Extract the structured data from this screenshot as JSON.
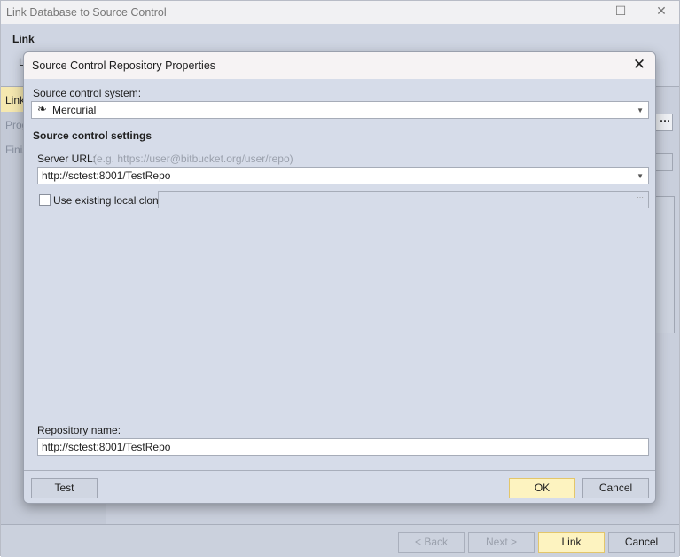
{
  "window": {
    "title": "Link Database to Source Control",
    "header_title": "Link",
    "header_sub": "L",
    "nav": [
      {
        "label": "Link"
      },
      {
        "label": "Prog"
      },
      {
        "label": "Finis"
      }
    ],
    "footer": {
      "back": "< Back",
      "next": "Next >",
      "link": "Link",
      "cancel": "Cancel"
    }
  },
  "dialog": {
    "title": "Source Control Repository Properties",
    "system_label": "Source control system:",
    "system_value": "Mercurial",
    "system_icon": "mercurial-icon",
    "settings_heading": "Source control settings",
    "server_url_label": "Server URL:",
    "server_url_hint": "(e.g. https://user@bitbucket.org/user/repo)",
    "server_url_value": "http://sctest:8001/TestRepo",
    "use_clone_label": "Use existing local clone",
    "use_clone_checked": false,
    "clone_path": "",
    "repo_name_label": "Repository name:",
    "repo_name_value": "http://sctest:8001/TestRepo",
    "test": "Test",
    "ok": "OK",
    "cancel": "Cancel"
  }
}
